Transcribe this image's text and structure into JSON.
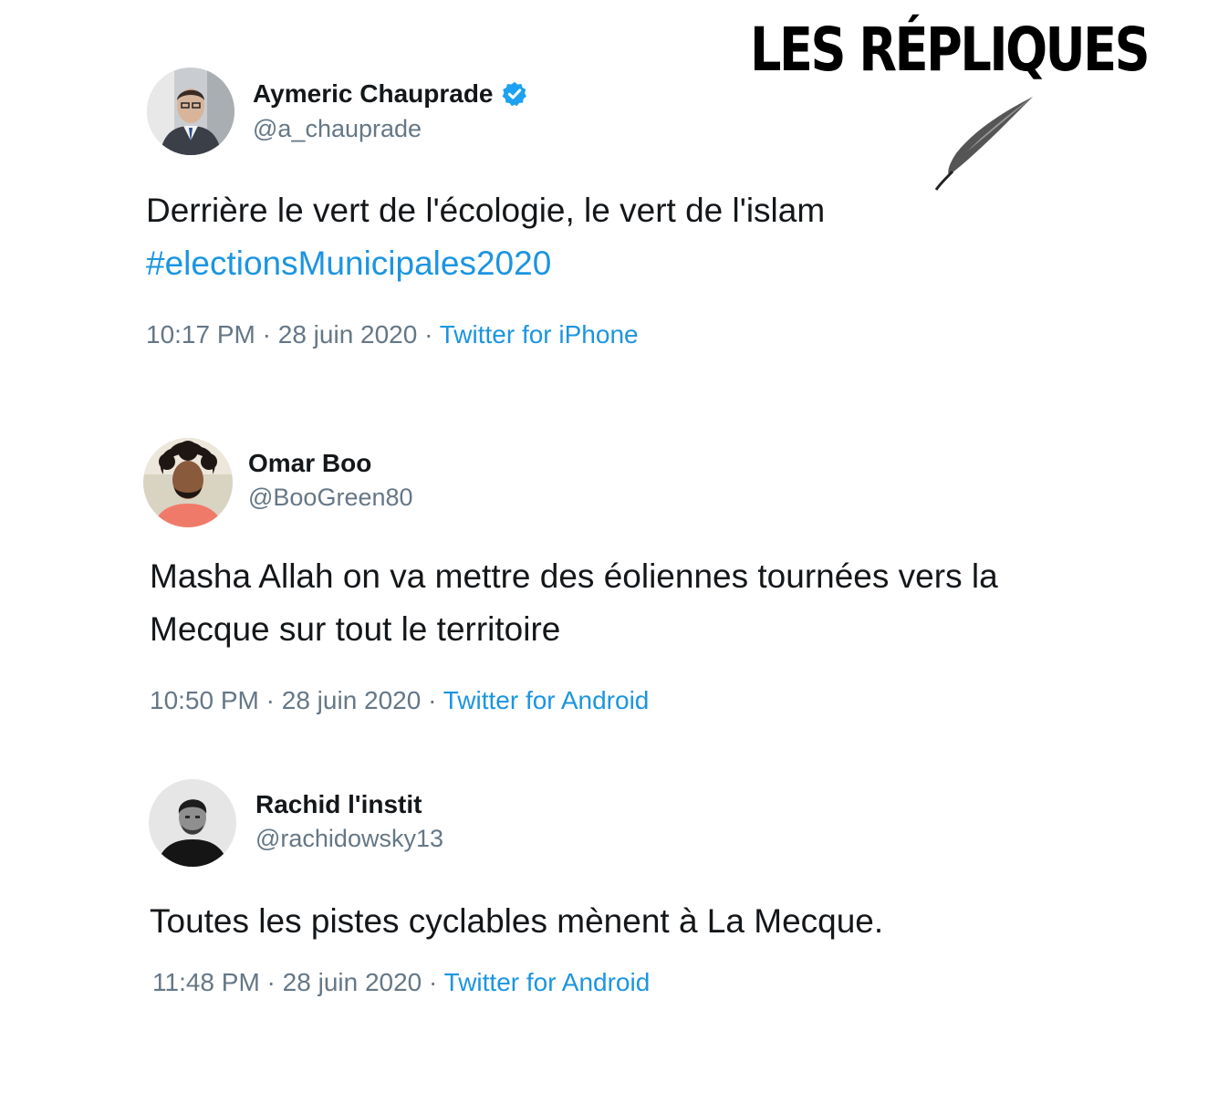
{
  "banner": {
    "text": "LES RÉPLIQUES"
  },
  "tweets": [
    {
      "name": "Aymeric Chauprade",
      "verified": true,
      "handle": "@a_chauprade",
      "lines": [
        "Derrière le vert de l'écologie, le vert de l'islam"
      ],
      "hashtag": "#electionsMunicipales2020",
      "time": "10:17 PM",
      "sep1": " · ",
      "date": "28 juin 2020",
      "sep2": " · ",
      "source": "Twitter for iPhone"
    },
    {
      "name": "Omar Boo",
      "verified": false,
      "handle": "@BooGreen80",
      "lines": [
        "Masha Allah on va mettre des éoliennes tournées vers la",
        "Mecque sur tout le territoire"
      ],
      "time": "10:50 PM",
      "sep1": " · ",
      "date": "28 juin 2020",
      "sep2": " · ",
      "source": "Twitter for Android"
    },
    {
      "name": "Rachid l'instit",
      "verified": false,
      "handle": "@rachidowsky13",
      "lines": [
        "Toutes les pistes cyclables mènent à La Mecque."
      ],
      "time": "11:48 PM",
      "sep1": " · ",
      "date": "28 juin 2020",
      "sep2": " · ",
      "source": "Twitter for Android"
    }
  ],
  "colors": {
    "text": "#14171a",
    "secondary": "#657786",
    "link": "#1b95e0",
    "verified_badge": "#1da1f2"
  },
  "icons": {
    "verified": "verified-badge-icon",
    "quill": "quill-feather-icon"
  }
}
